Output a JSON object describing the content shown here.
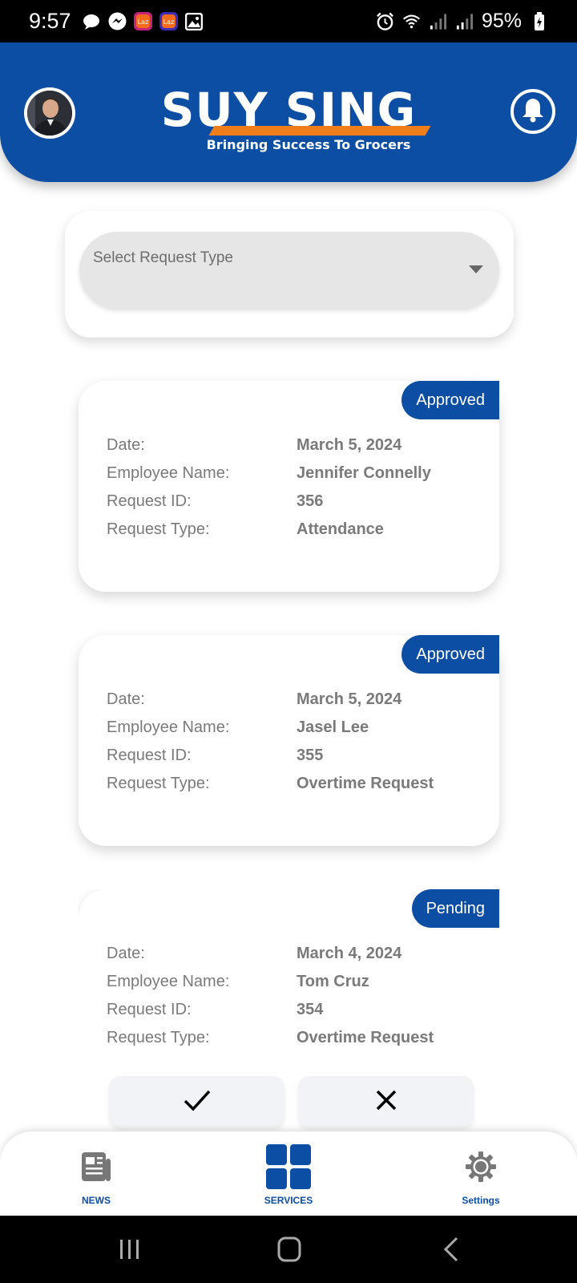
{
  "status_bar": {
    "time": "9:57",
    "battery": "95%"
  },
  "header": {
    "logo_title": "SUY SING",
    "logo_tagline": "Bringing Success To Grocers"
  },
  "filter": {
    "placeholder": "Select Request Type"
  },
  "field_labels": {
    "date": "Date:",
    "employee_name": "Employee Name:",
    "request_id": "Request ID:",
    "request_type": "Request Type:"
  },
  "requests": [
    {
      "status": "Approved",
      "date": "March 5, 2024",
      "employee_name": "Jennifer Connelly",
      "request_id": "356",
      "request_type": "Attendance"
    },
    {
      "status": "Approved",
      "date": "March 5, 2024",
      "employee_name": "Jasel Lee",
      "request_id": "355",
      "request_type": "Overtime Request"
    },
    {
      "status": "Pending",
      "date": "March 4, 2024",
      "employee_name": "Tom Cruz",
      "request_id": "354",
      "request_type": "Overtime Request"
    }
  ],
  "bottom_nav": {
    "news": "NEWS",
    "services": "SERVICES",
    "settings": "Settings"
  },
  "colors": {
    "brand_blue": "#0c4ea3",
    "brand_orange": "#ef7d1a",
    "settings_label": "#0c4ea3"
  }
}
